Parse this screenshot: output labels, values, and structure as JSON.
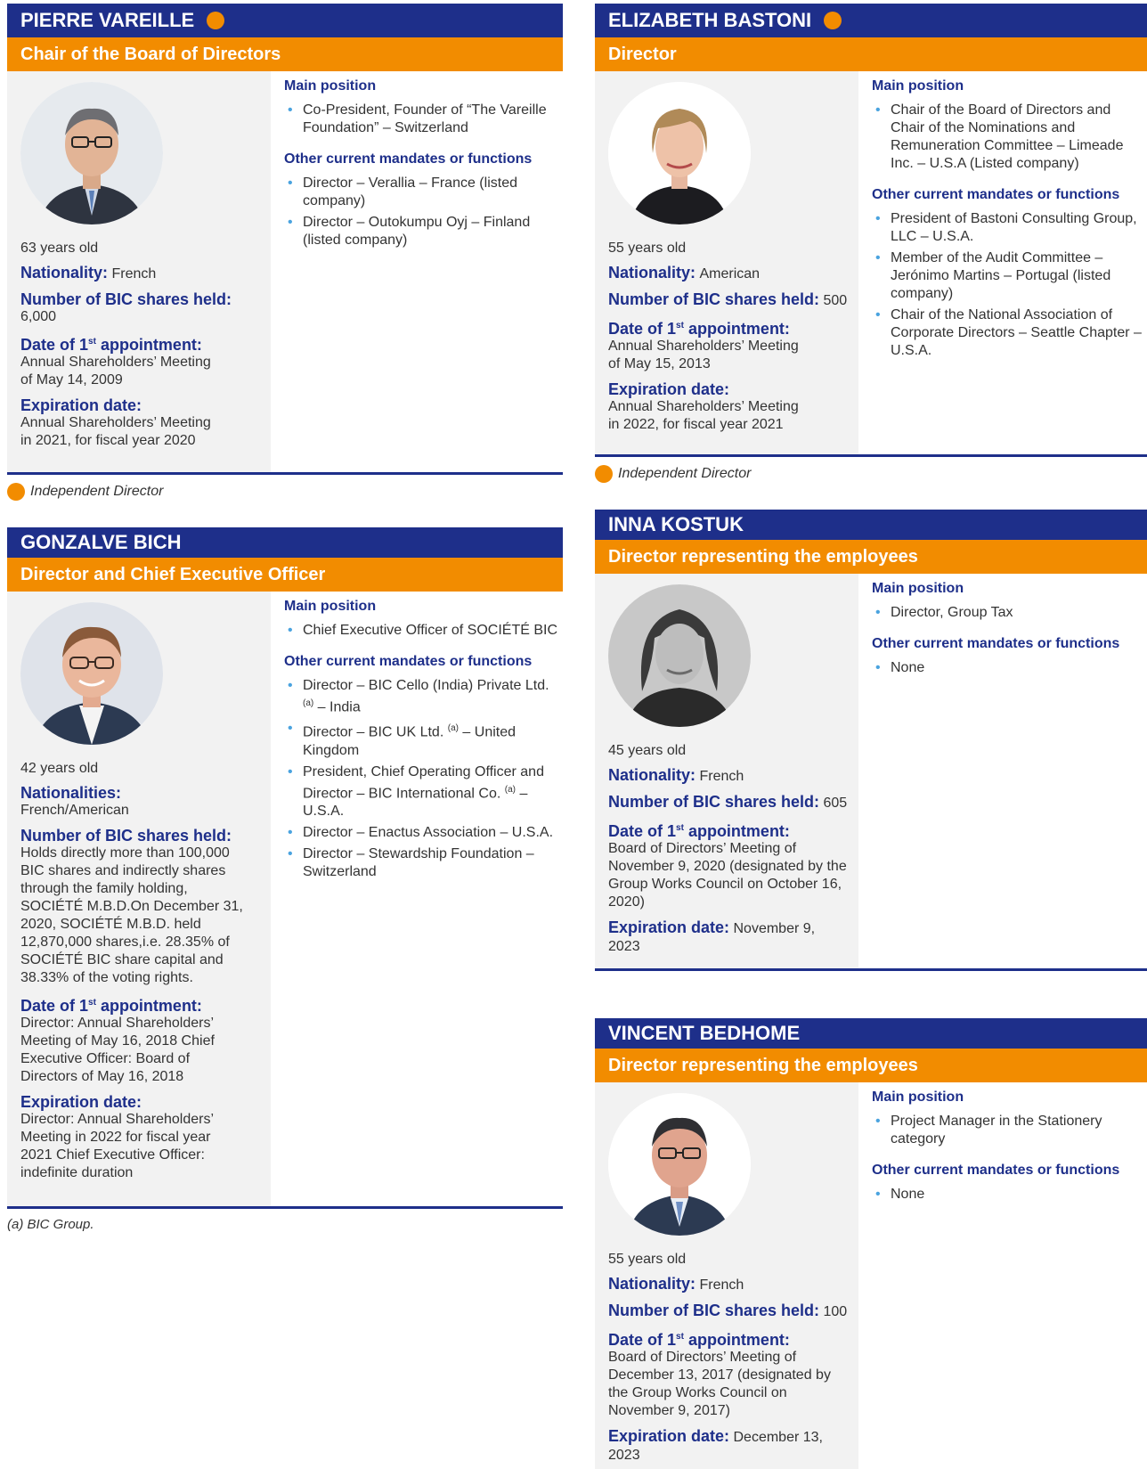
{
  "colors": {
    "navy": "#1e2f8a",
    "orange": "#f28c00",
    "panel_gray": "#f2f2f2",
    "bullet_blue": "#4aa3df"
  },
  "labels": {
    "main_position": "Main position",
    "other_mandates": "Other current mandates or functions",
    "nationality": "Nationality:",
    "nationalities": "Nationalities:",
    "shares": "Number of BIC shares held:",
    "first_appt_pre": "Date of 1",
    "first_appt_sup": "st",
    "first_appt_post": " appointment:",
    "expiration": "Expiration date:"
  },
  "legend": {
    "independent": "Independent Director",
    "icon": "independent-dot"
  },
  "footnote": "(a) BIC Group.",
  "directors": {
    "vareille": {
      "name": "PIERRE VAREILLE",
      "role": "Chair of the Board of Directors",
      "age": "63 years old",
      "nationality": "French",
      "shares": "6,000",
      "first_appointment": "Annual Shareholders’ Meeting of May 14, 2009",
      "expiration": "Annual Shareholders’ Meeting in 2021, for fiscal year 2020",
      "main_position": [
        "Co-President, Founder of “The Vareille Foundation” – Switzerland"
      ],
      "mandates": [
        "Director – Verallia – France (listed company)",
        "Director – Outokumpu Oyj – Finland (listed company)"
      ]
    },
    "bich": {
      "name": "GONZALVE BICH",
      "role": "Director and Chief Executive Officer",
      "age": "42 years old",
      "nationality": "French/American",
      "shares": "Holds directly more than 100,000 BIC shares and indirectly shares through the family holding, SOCIÉTÉ M.B.D.On December 31, 2020, SOCIÉTÉ M.B.D. held 12,870,000 shares,i.e. 28.35% of SOCIÉTÉ BIC share capital and 38.33% of the voting rights.",
      "first_appointment": "Director: Annual Shareholders’ Meeting of May 16, 2018 Chief Executive Officer: Board of Directors of May 16, 2018",
      "expiration": "Director: Annual Shareholders’ Meeting in 2022 for fiscal year 2021 Chief Executive Officer: indefinite duration",
      "main_position": [
        "Chief Executive Officer of SOCIÉTÉ BIC"
      ],
      "mandates_a": {
        "m1_pre": "Director – BIC Cello (India) Private Ltd.",
        "m1_sup": "(a)",
        "m1_post": " – India",
        "m2_pre": "Director – BIC UK Ltd.",
        "m2_sup": "(a)",
        "m2_post": " – United Kingdom",
        "m3_pre": "President, Chief Operating Officer and Director – BIC International Co.",
        "m3_sup": "(a)",
        "m3_post": " – U.S.A.",
        "m4": "Director – Enactus Association – U.S.A.",
        "m5": "Director – Stewardship Foundation – Switzerland"
      }
    },
    "bastoni": {
      "name": "ELIZABETH BASTONI",
      "role": "Director",
      "age": "55 years old",
      "nationality": "American",
      "shares": "500",
      "first_appointment": "Annual Shareholders’ Meeting of May 15, 2013",
      "expiration": "Annual Shareholders’ Meeting in 2022, for fiscal year 2021",
      "main_position": [
        "Chair of the Board of Directors and Chair of the Nominations and Remuneration Committee – Limeade Inc. – U.S.A (Listed company)"
      ],
      "mandates": [
        "President of Bastoni Consulting Group, LLC – U.S.A.",
        "Member of the Audit Committee – Jerónimo Martins – Portugal (listed company)",
        "Chair of the National Association of Corporate Directors – Seattle Chapter – U.S.A."
      ]
    },
    "kostuk": {
      "name": "INNA KOSTUK",
      "role": "Director representing the employees",
      "age": "45 years old",
      "nationality": "French",
      "shares": "605",
      "first_appointment": "Board of Directors’ Meeting of November 9, 2020 (designated by the Group Works Council on October 16, 2020)",
      "expiration": "November 9, 2023",
      "main_position": [
        "Director, Group Tax"
      ],
      "mandates": [
        "None"
      ]
    },
    "bedhome": {
      "name": "VINCENT BEDHOME",
      "role": "Director representing the employees",
      "age": "55 years old",
      "nationality": "French",
      "shares": "100",
      "first_appointment": "Board of Directors’ Meeting of December 13, 2017 (designated by the Group Works Council on November 9, 2017)",
      "expiration": "December 13, 2023",
      "main_position": [
        "Project Manager in the Stationery category"
      ],
      "mandates": [
        "None"
      ]
    }
  }
}
